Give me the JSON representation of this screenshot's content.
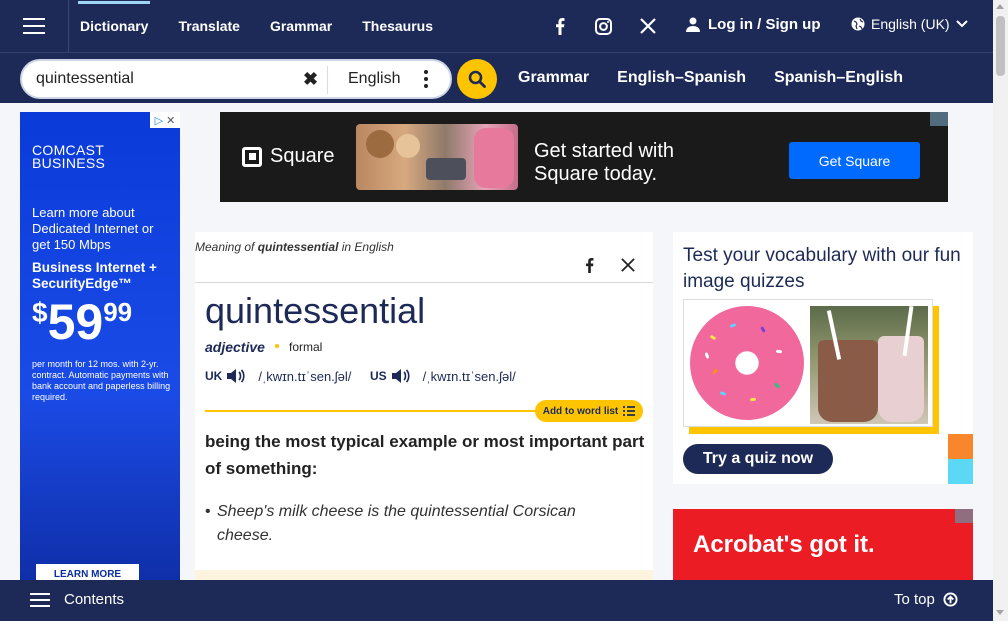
{
  "header": {
    "nav": [
      "Dictionary",
      "Translate",
      "Grammar",
      "Thesaurus"
    ],
    "login_label": "Log in / Sign up",
    "language": "English (UK)"
  },
  "search": {
    "value": "quintessential",
    "dictionary": "English",
    "quicklinks": [
      "Grammar",
      "English–Spanish",
      "Spanish–English"
    ]
  },
  "ad_left": {
    "brand_line1": "COMCAST",
    "brand_line2": "BUSINESS",
    "text": "Learn more about Dedicated Internet or get 150 Mbps",
    "headline": "Business Internet + SecurityEdge™",
    "price_symbol": "$",
    "price_main": "59",
    "price_cents": "99",
    "fine_print": "per month for 12 mos. with 2-yr. contract. Automatic payments with bank account and paperless billing required.",
    "cta": "LEARN MORE"
  },
  "ad_top": {
    "brand": "Square",
    "tagline_line1": "Get started with",
    "tagline_line2": "Square today.",
    "cta": "Get Square"
  },
  "entry": {
    "meaning_prefix": "Meaning of",
    "meaning_word": "quintessential",
    "meaning_suffix": "in English",
    "headword": "quintessential",
    "pos": "adjective",
    "register": "formal",
    "uk_label": "UK",
    "uk_ipa": "/ˌkwɪn.tɪˈsen.ʃəl/",
    "us_label": "US",
    "us_ipa": "/ˌkwɪn.tɪˈsen.ʃəl/",
    "add_to_list": "Add to word list",
    "definition": "being the most typical example or most important part of something:",
    "example": "Sheep's milk cheese is the quintessential Corsican cheese."
  },
  "quiz": {
    "title": "Test your vocabulary with our fun image quizzes",
    "button": "Try a quiz now"
  },
  "ad_acrobat": {
    "text": "Acrobat's got it."
  },
  "footer": {
    "contents": "Contents",
    "to_top": "To top"
  },
  "colors": {
    "navy": "#1d2a57",
    "accent_yellow": "#fec400",
    "square_blue": "#006aff",
    "acrobat_red": "#ec1c24",
    "comcast_blue": "#0a3bd9"
  }
}
